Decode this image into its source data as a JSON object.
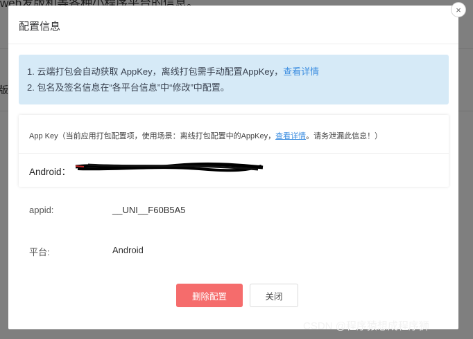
{
  "background": {
    "top_text": "web发版和等各种小程序平台的信息。",
    "left_text": "版"
  },
  "dialog": {
    "title": "配置信息",
    "close_glyph": "×",
    "notice": {
      "line1_prefix": "1. 云端打包会自动获取 AppKey，离线打包需手动配置AppKey，",
      "line1_link": "查看详情",
      "line2": "2. 包名及签名信息在“各平台信息”中“修改”中配置。"
    },
    "appkey_card": {
      "head_prefix": "App Key（当前应用打包配置项，使用场景：离线打包配置中的AppKey，",
      "head_link": "查看详情",
      "head_suffix": "。请务泄漏此信息！）",
      "android_label": "Android："
    },
    "fields": [
      {
        "label": "appid:",
        "value": "__UNI__F60B5A5"
      },
      {
        "label": "平台:",
        "value": "Android"
      }
    ],
    "buttons": {
      "delete": "删除配置",
      "close": "关闭"
    }
  },
  "watermark": "CSDN @程序猿想成程序狮",
  "colors": {
    "notice_bg": "#d6eaf7",
    "link": "#3d8ee0",
    "danger": "#f56c6c"
  }
}
